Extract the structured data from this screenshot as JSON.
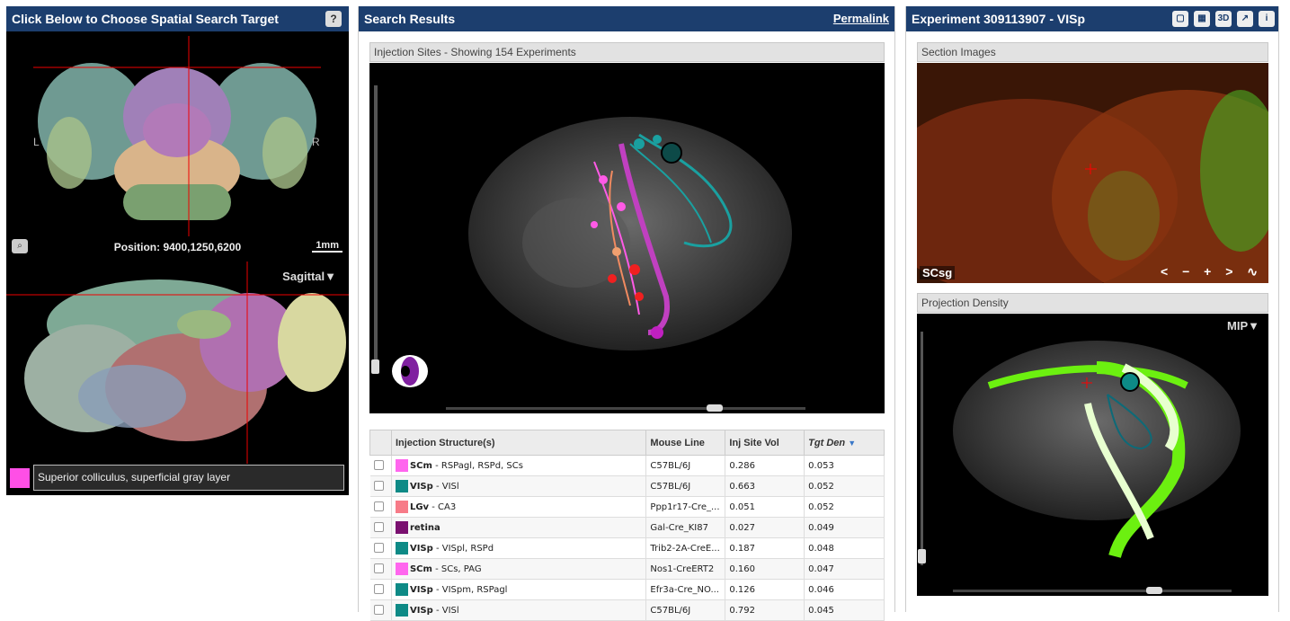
{
  "left_panel": {
    "title": "Click Below to Choose Spatial Search Target",
    "help_label": "?",
    "left_marker": "L",
    "right_marker": "R",
    "position_text": "Position: 9400,1250,6200",
    "scale_label": "1mm",
    "zoom_icon": "magnifier-icon",
    "view_select": "Sagittal▼",
    "selected_structure": "Superior colliculus, superficial gray layer",
    "selected_structure_color": "#ff4fe6"
  },
  "middle_panel": {
    "title": "Search Results",
    "permalink": "Permalink",
    "subheader": "Injection Sites - Showing 154 Experiments",
    "table": {
      "columns": [
        "Injection Structure(s)",
        "Mouse Line",
        "Inj Site Vol",
        "Tgt Den"
      ],
      "sort_indicator": "▼",
      "rows": [
        {
          "color": "#ff66ee",
          "primary": "SCm",
          "secondary": " - RSPagl, RSPd, SCs",
          "line": "C57BL/6J",
          "vol": "0.286",
          "den": "0.053"
        },
        {
          "color": "#0e8a86",
          "primary": "VISp",
          "secondary": " - VISl",
          "line": "C57BL/6J",
          "vol": "0.663",
          "den": "0.052"
        },
        {
          "color": "#f77b88",
          "primary": "LGv",
          "secondary": " - CA3",
          "line": "Ppp1r17-Cre_...",
          "vol": "0.051",
          "den": "0.052"
        },
        {
          "color": "#7a1070",
          "primary": "retina",
          "secondary": "",
          "line": "Gal-Cre_KI87",
          "vol": "0.027",
          "den": "0.049"
        },
        {
          "color": "#0e8a86",
          "primary": "VISp",
          "secondary": " - VISpl, RSPd",
          "line": "Trib2-2A-CreE...",
          "vol": "0.187",
          "den": "0.048"
        },
        {
          "color": "#ff66ee",
          "primary": "SCm",
          "secondary": " - SCs, PAG",
          "line": "Nos1-CreERT2",
          "vol": "0.160",
          "den": "0.047"
        },
        {
          "color": "#0e8a86",
          "primary": "VISp",
          "secondary": " - VISpm, RSPagl",
          "line": "Efr3a-Cre_NO...",
          "vol": "0.126",
          "den": "0.046"
        },
        {
          "color": "#0e8a86",
          "primary": "VISp",
          "secondary": " - VISl",
          "line": "C57BL/6J",
          "vol": "0.792",
          "den": "0.045"
        }
      ]
    }
  },
  "right_panel": {
    "title": "Experiment 309113907 - VISp",
    "header_icons": [
      "layout-single-icon",
      "layout-grid-icon",
      "3d-icon",
      "export-icon",
      "info-icon"
    ],
    "header_icon_labels": [
      "▢",
      "▦",
      "3D",
      "↗",
      "i"
    ],
    "section_title": "Section Images",
    "section_label": "SCsg",
    "section_nav": "< − + > ∿",
    "density_title": "Projection Density",
    "mip_label": "MIP▼"
  }
}
